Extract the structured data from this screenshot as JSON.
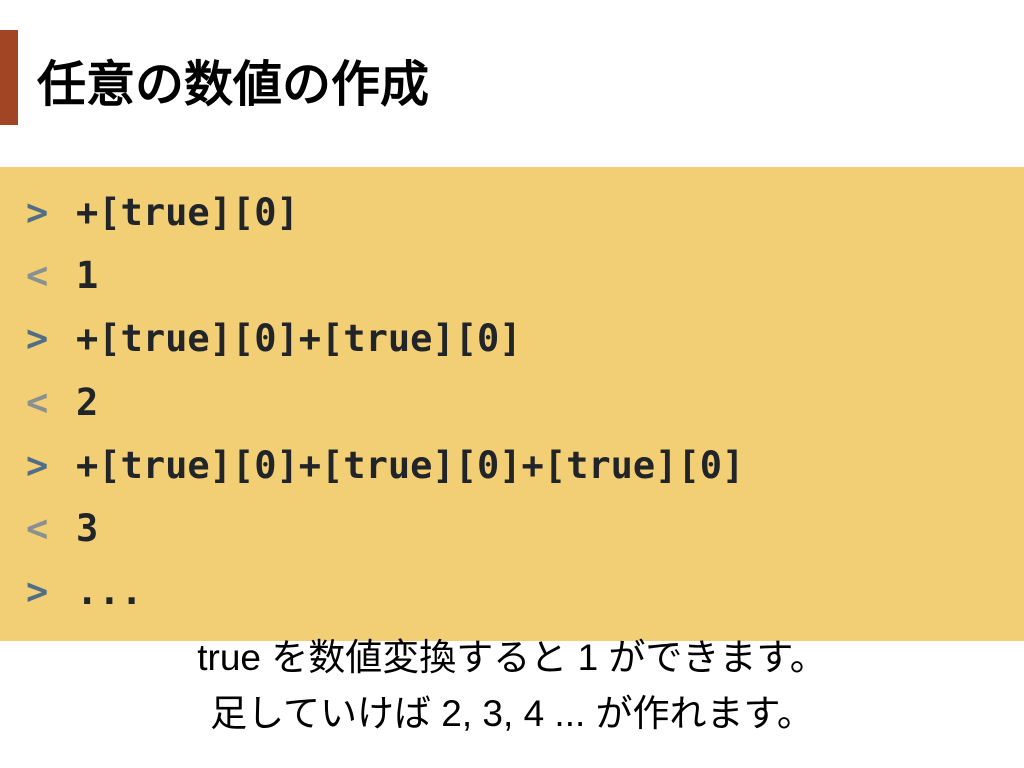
{
  "heading": "任意の数値の作成",
  "console": {
    "rows": [
      {
        "dir": "in",
        "prompt": ">",
        "text": "+[true][0]"
      },
      {
        "dir": "out",
        "prompt": "<",
        "text": "1"
      },
      {
        "dir": "in",
        "prompt": ">",
        "text": "+[true][0]+[true][0]"
      },
      {
        "dir": "out",
        "prompt": "<",
        "text": "2"
      },
      {
        "dir": "in",
        "prompt": ">",
        "text": "+[true][0]+[true][0]+[true][0]"
      },
      {
        "dir": "out",
        "prompt": "<",
        "text": "3"
      },
      {
        "dir": "in",
        "prompt": ">",
        "text": "..."
      }
    ]
  },
  "caption_line1": "true を数値変換すると 1 ができます。",
  "caption_line2": "足していけば 2, 3, 4 ... が作れます。"
}
